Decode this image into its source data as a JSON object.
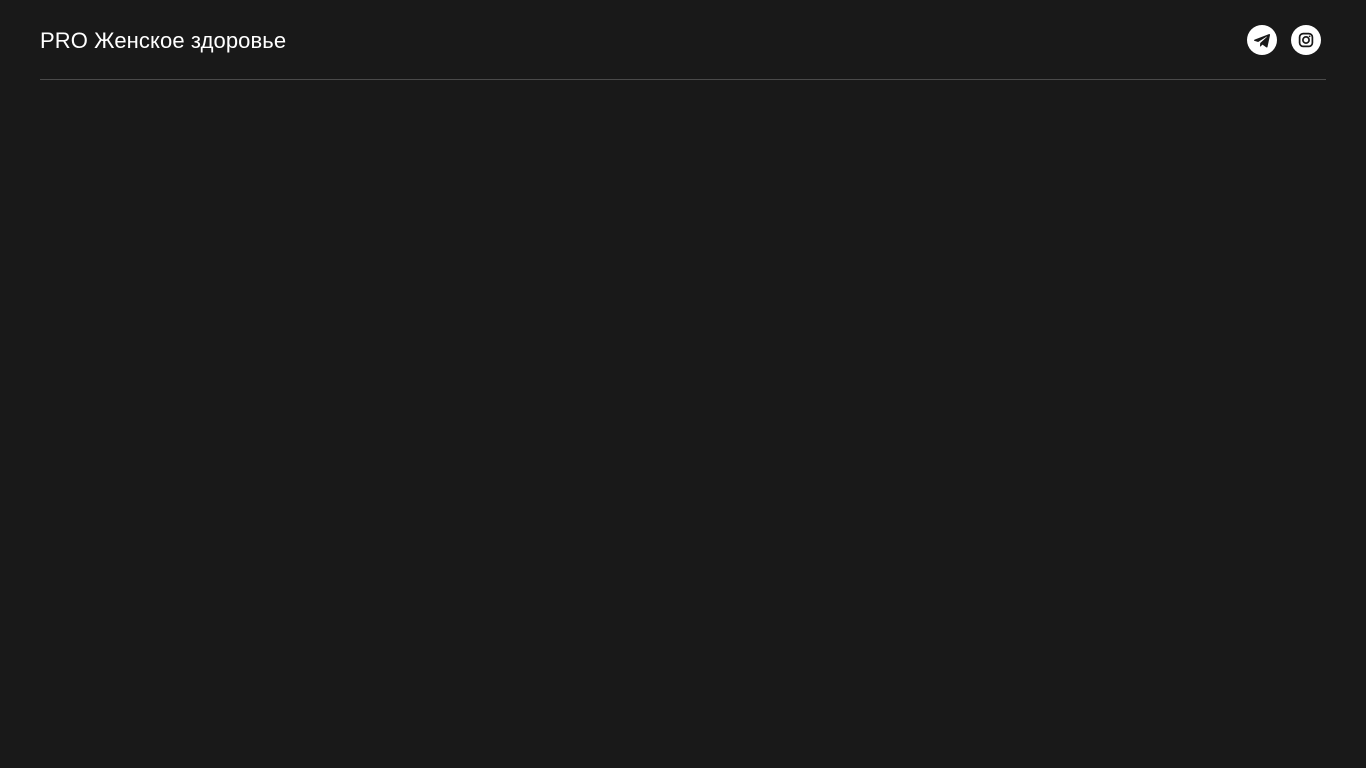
{
  "header": {
    "title": "PRO Женское здоровье",
    "socials": [
      {
        "icon": "telegram-icon"
      },
      {
        "icon": "instagram-icon"
      }
    ]
  },
  "colors": {
    "background": "#191919",
    "text": "#ffffff",
    "divider": "#4a4a4a",
    "icon_bg": "#ffffff",
    "icon_fg": "#191919"
  }
}
